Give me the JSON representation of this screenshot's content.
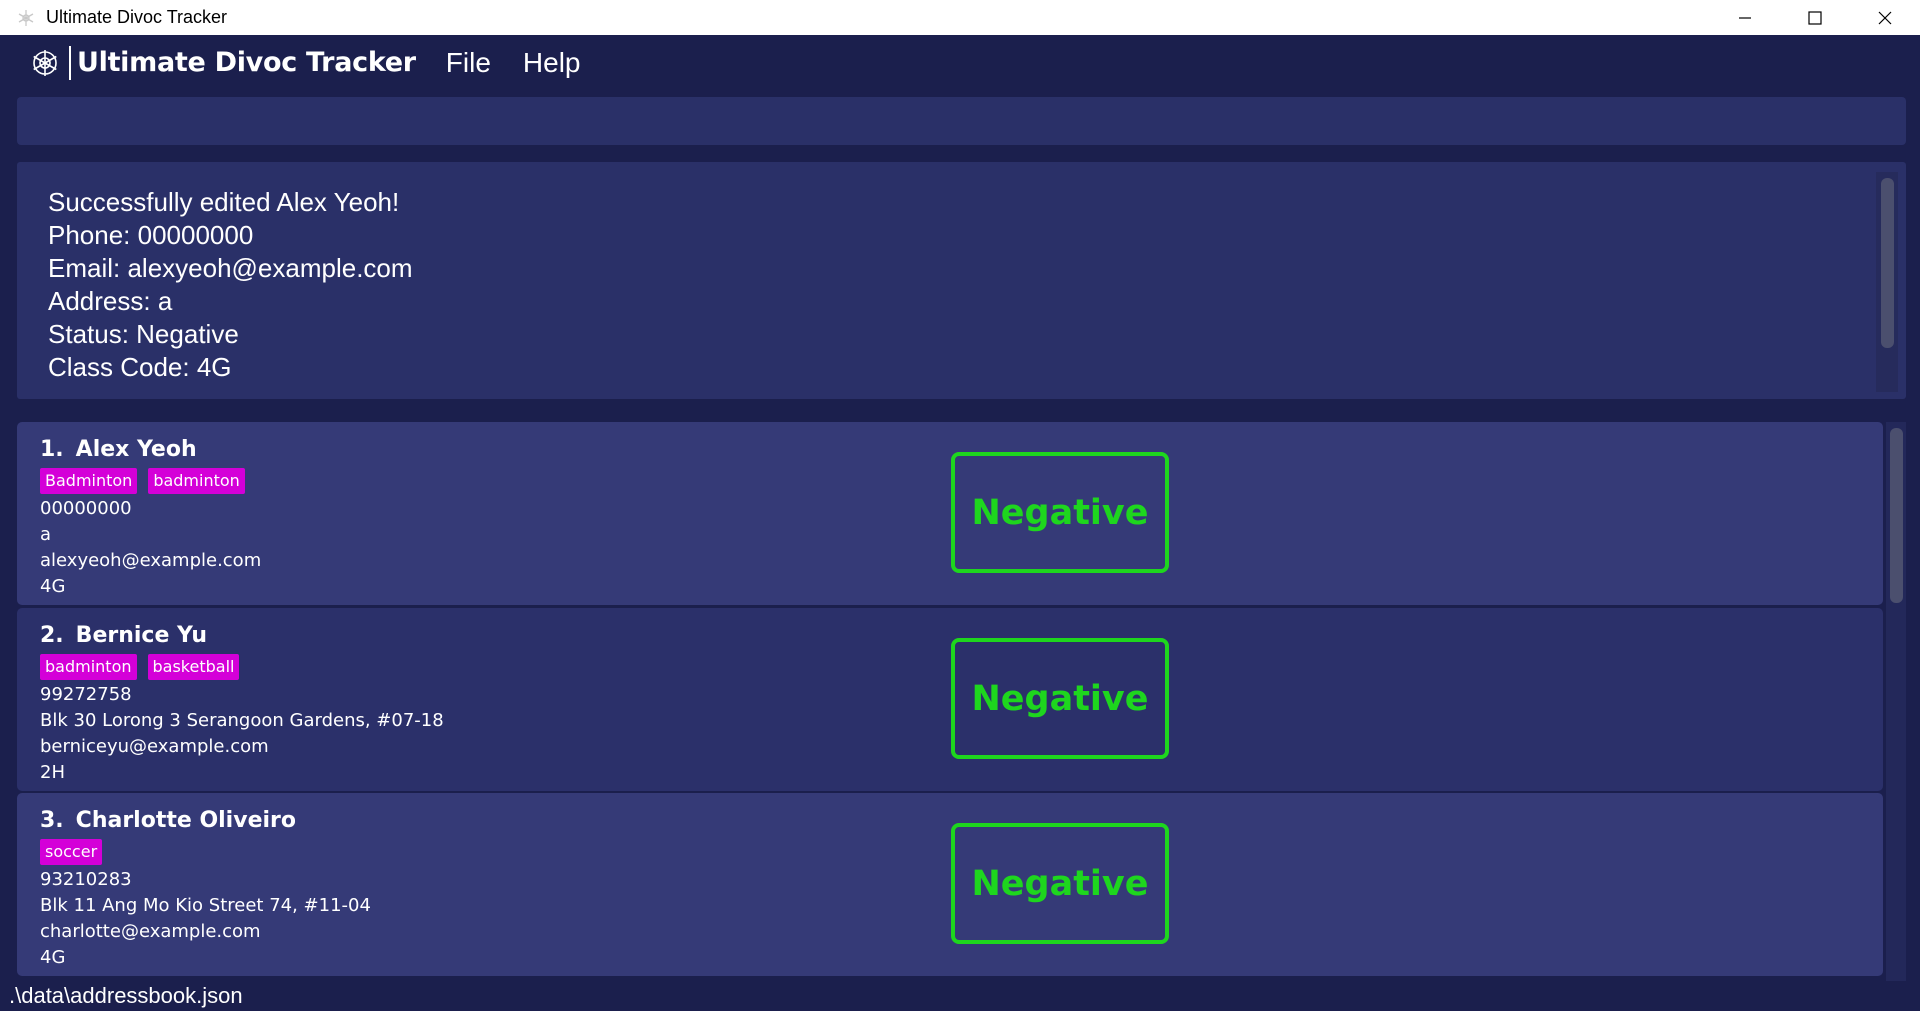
{
  "window": {
    "title": "Ultimate Divoc Tracker",
    "controls": [
      "minimize-icon",
      "maximize-icon",
      "close-icon"
    ]
  },
  "app": {
    "brand": "Ultimate Divoc Tracker",
    "logo_icon": "snowflake-gear-icon",
    "menu": [
      {
        "label": "File"
      },
      {
        "label": "Help"
      }
    ]
  },
  "command_box": {
    "value": "",
    "placeholder": ""
  },
  "result": {
    "lines": [
      "Successfully edited Alex Yeoh!",
      "Phone: 00000000",
      "Email: alexyeoh@example.com",
      "Address: a",
      "Status: Negative",
      "Class Code: 4G"
    ]
  },
  "persons": [
    {
      "index": "1.",
      "name": "Alex Yeoh",
      "tags": [
        "Badminton",
        "badminton"
      ],
      "phone": "00000000",
      "address": "a",
      "email": "alexyeoh@example.com",
      "class_code": "4G",
      "status": "Negative"
    },
    {
      "index": "2.",
      "name": "Bernice Yu",
      "tags": [
        "badminton",
        "basketball"
      ],
      "phone": "99272758",
      "address": "Blk 30 Lorong 3 Serangoon Gardens, #07-18",
      "email": "berniceyu@example.com",
      "class_code": "2H",
      "status": "Negative"
    },
    {
      "index": "3.",
      "name": "Charlotte Oliveiro",
      "tags": [
        "soccer"
      ],
      "phone": "93210283",
      "address": "Blk 11 Ang Mo Kio Street 74, #11-04",
      "email": "charlotte@example.com",
      "class_code": "4G",
      "status": "Negative"
    }
  ],
  "statusbar": {
    "path": ".\\data\\addressbook.json"
  },
  "colors": {
    "background": "#1b1f4d",
    "panel": "#2a3068",
    "card": "#353a77",
    "card_alt": "#2b306a",
    "tag": "#d400d8",
    "status_negative": "#1ed61e"
  }
}
